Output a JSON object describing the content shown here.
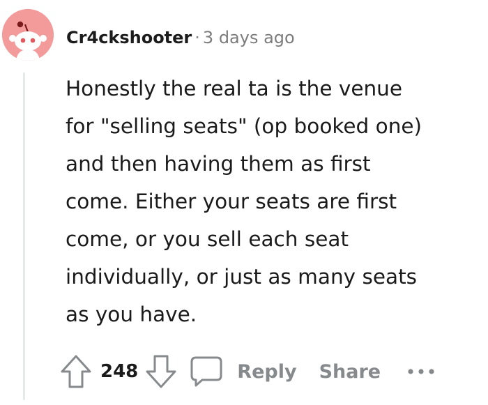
{
  "comment": {
    "username": "Cr4ckshooter",
    "separator": "·",
    "timestamp": "3 days ago",
    "body_lines": [
      "Honestly the real ta is the venue",
      "for \"selling seats\" (op booked one)",
      "and then having them as first",
      "come. Either your seats are first",
      "come, or you sell each seat",
      "individually, or just as many seats",
      "as you have."
    ]
  },
  "actions": {
    "vote_count": "248",
    "reply_label": "Reply",
    "share_label": "Share"
  },
  "icons": {
    "avatar": "reddit-snoo-avatar-icon",
    "upvote": "upvote-arrow-icon",
    "downvote": "downvote-arrow-icon",
    "reply": "speech-bubble-icon",
    "more": "more-options-icon"
  },
  "colors": {
    "avatar_bg": "#f39a9b",
    "muted_text": "#878a8c",
    "thread_line": "#e6e8ea"
  }
}
